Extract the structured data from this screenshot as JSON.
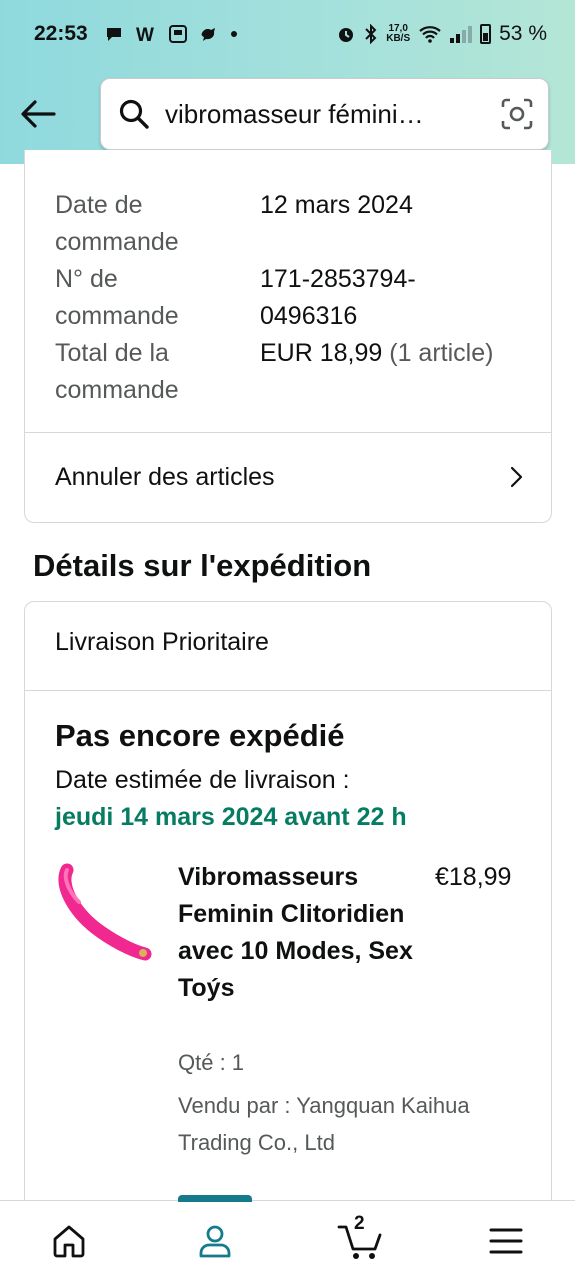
{
  "status_bar": {
    "time": "22:53",
    "network_speed": "17,0",
    "network_speed_unit": "KB/S",
    "battery": "53 %"
  },
  "search": {
    "query": "vibromasseur fémini…"
  },
  "order": {
    "date_label": "Date de commande",
    "date_value": "12 mars 2024",
    "number_label": "N° de commande",
    "number_value": "171-2853794-0496316",
    "total_label": "Total de la commande",
    "total_value": "EUR 18,99",
    "total_items": "(1 article)",
    "cancel_label": "Annuler des articles"
  },
  "shipping": {
    "section_title": "Détails sur l'expédition",
    "method": "Livraison Prioritaire",
    "status": "Pas encore expédié",
    "eta_label": "Date estimée de livraison :",
    "eta_date": "jeudi 14 mars 2024 avant 22 h",
    "product": {
      "title": "Vibromasseurs Feminin Clitoridien avec 10 Modes, Sex Toýs",
      "price": "€18,99",
      "qty": "Qté : 1",
      "seller": "Vendu par : Yangquan Kaihua Trading Co., Ltd",
      "image_color": "#f0288f"
    }
  },
  "bottom_nav": {
    "cart_count": "2",
    "active_color": "#157a8c"
  }
}
